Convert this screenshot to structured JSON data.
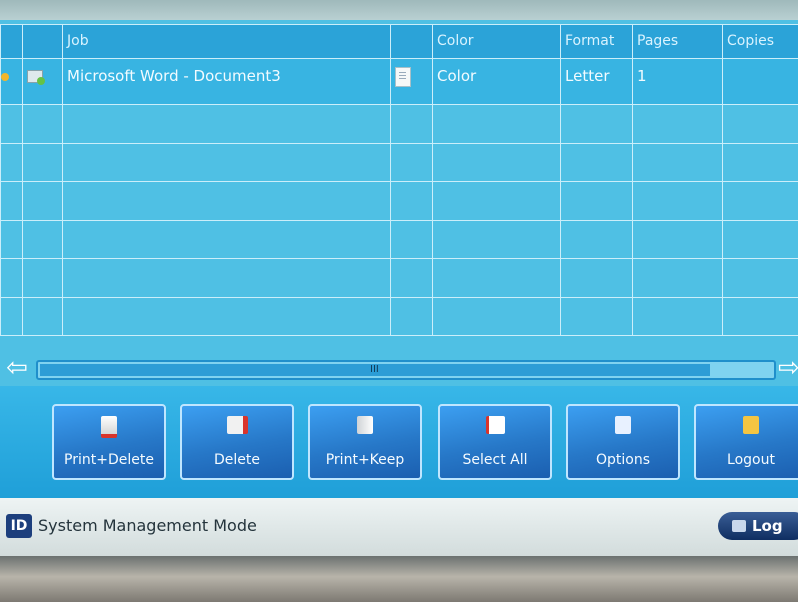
{
  "table": {
    "headers": [
      "",
      "",
      "Job",
      "",
      "Color",
      "Format",
      "Pages",
      "Copies"
    ],
    "row": {
      "job": "Microsoft Word - Document3",
      "color": "Color",
      "format": "Letter",
      "pages": "1",
      "copies": ""
    }
  },
  "scrollbar": {
    "left_arrow": "⇦",
    "right_arrow": "⇨",
    "grip": "III"
  },
  "buttons": {
    "print_delete": "Print+Delete",
    "delete": "Delete",
    "print_keep": "Print+Keep",
    "select_all": "Select All",
    "options": "Options",
    "logout": "Logout"
  },
  "status": {
    "badge": "ID",
    "mode": "System Management Mode",
    "log": "Log"
  },
  "colors": {
    "screen": "#4fc0e4",
    "button": "#2778c8",
    "status_bar": "#e4ecec"
  }
}
